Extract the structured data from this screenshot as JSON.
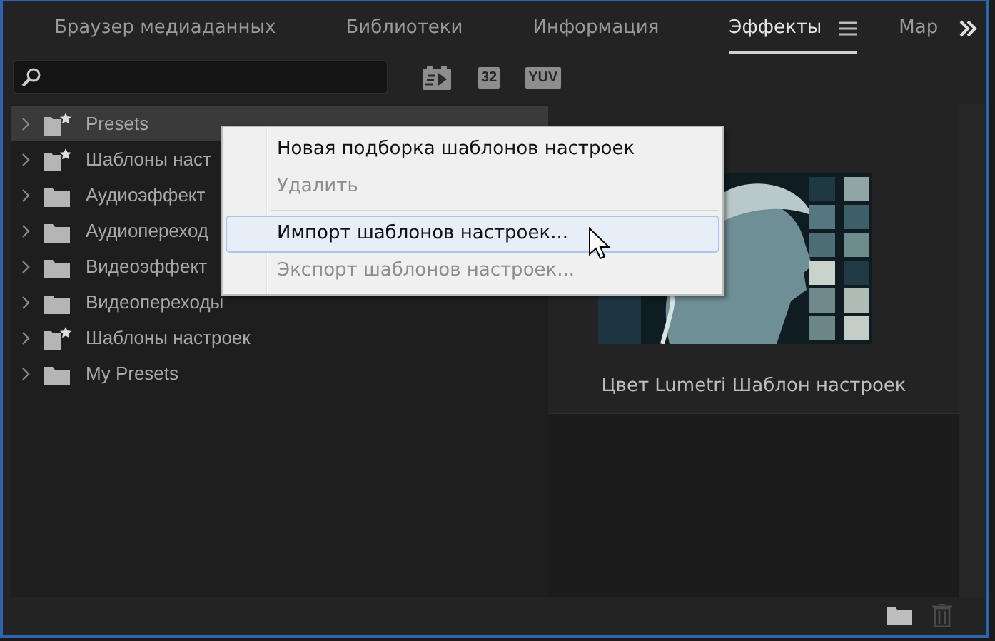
{
  "tabs": [
    {
      "label": "Браузер медиаданных",
      "selected": false
    },
    {
      "label": "Библиотеки",
      "selected": false
    },
    {
      "label": "Информация",
      "selected": false
    },
    {
      "label": "Эффекты",
      "selected": true
    },
    {
      "label": "Мар",
      "selected": false
    }
  ],
  "filter_badges": [
    {
      "kind": "accelerated"
    },
    {
      "kind": "text",
      "label": "32"
    },
    {
      "kind": "text",
      "label": "YUV"
    }
  ],
  "tree": [
    {
      "label": "Presets",
      "kind": "preset",
      "selected": true
    },
    {
      "label": "Шаблоны наст",
      "kind": "preset",
      "selected": false
    },
    {
      "label": "Аудиоэффект",
      "kind": "folder",
      "selected": false
    },
    {
      "label": "Аудиопереход",
      "kind": "folder",
      "selected": false
    },
    {
      "label": "Видеоэффект",
      "kind": "folder",
      "selected": false
    },
    {
      "label": "Видеопереходы",
      "kind": "folder",
      "selected": false
    },
    {
      "label": "Шаблоны настроек",
      "kind": "preset",
      "selected": false
    },
    {
      "label": "My Presets",
      "kind": "folder",
      "selected": false
    }
  ],
  "preview": {
    "kind": "picture",
    "caption": "Цвет Lumetri Шаблон настроек"
  },
  "context_menu": [
    {
      "label": "Новая подборка шаблонов настроек",
      "disabled": false,
      "selected": false
    },
    {
      "label": "Удалить",
      "disabled": true,
      "selected": false
    },
    {
      "kind": "separator"
    },
    {
      "label": "Импорт шаблонов настроек...",
      "disabled": false,
      "selected": true
    },
    {
      "label": "Экспорт шаблонов настроек...",
      "disabled": true,
      "selected": false
    }
  ]
}
